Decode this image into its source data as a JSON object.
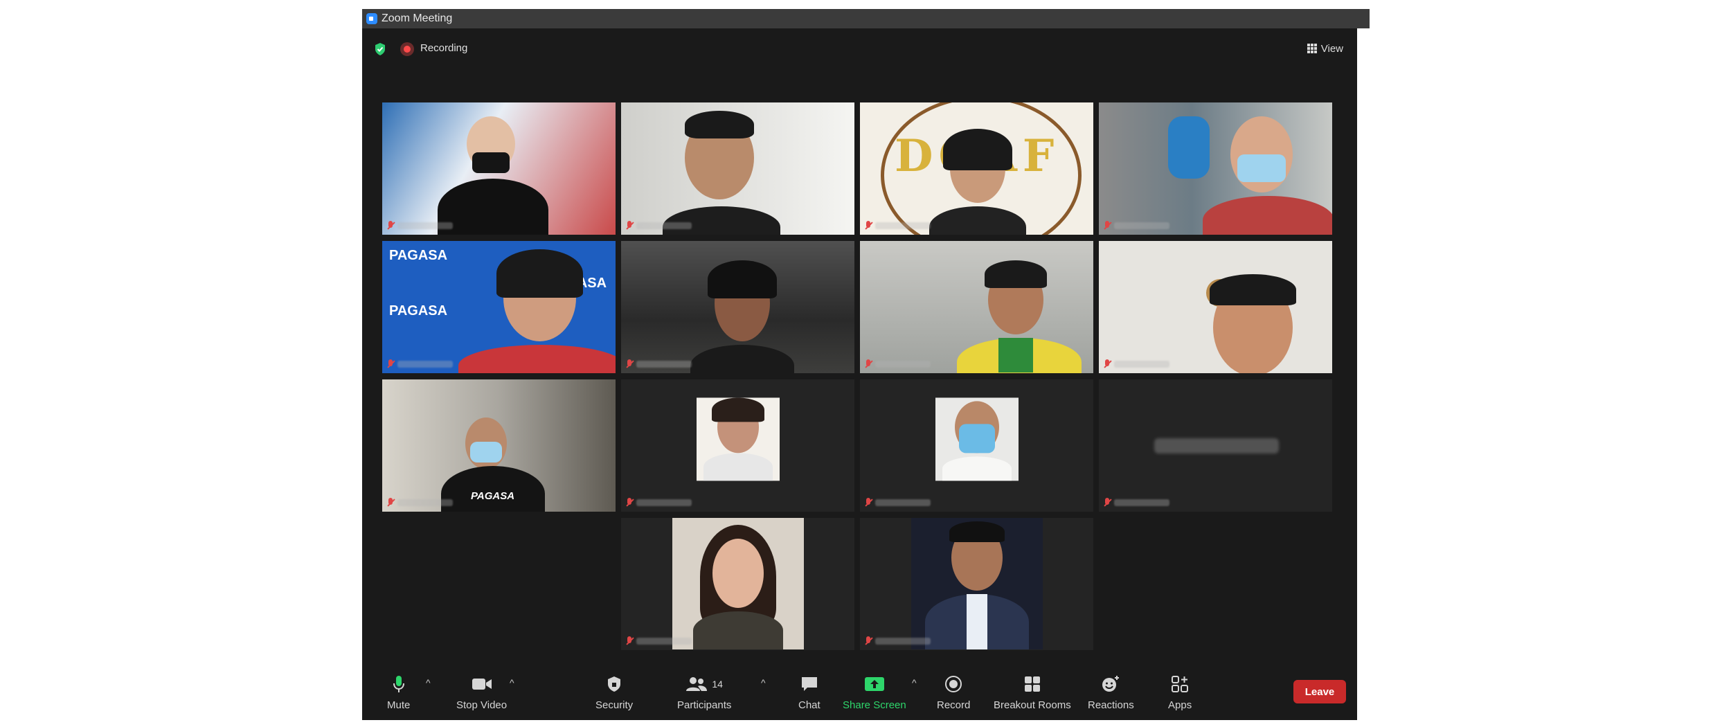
{
  "window": {
    "title": "Zoom Meeting"
  },
  "topbar": {
    "recording_label": "Recording",
    "view_label": "View"
  },
  "participants_count": "14",
  "tiles": [
    {
      "id": "t1",
      "bg": "#2f6fb5"
    },
    {
      "id": "t2",
      "bg": "#d8d8d6",
      "active": true
    },
    {
      "id": "t3",
      "bg": "#f3efe6",
      "sign": "DOAF"
    },
    {
      "id": "t4",
      "bg": "#7a8a90"
    },
    {
      "id": "t5",
      "bg": "#1e5ec0",
      "sign": "PAGASA"
    },
    {
      "id": "t6",
      "bg": "#3a3a38"
    },
    {
      "id": "t7",
      "bg": "#c9c9c5"
    },
    {
      "id": "t8",
      "bg": "#e6e4df"
    },
    {
      "id": "t9",
      "bg": "#c8c4bb",
      "shirt": "PAGASA"
    },
    {
      "id": "t10",
      "bg": "#242424",
      "avatar": true
    },
    {
      "id": "t11",
      "bg": "#242424",
      "avatar": true
    },
    {
      "id": "t12",
      "bg": "#242424"
    },
    {
      "id": "t13",
      "bg": "#242424",
      "avatar": true
    },
    {
      "id": "t14",
      "bg": "#242424",
      "avatar": true
    }
  ],
  "toolbar": {
    "mute": "Mute",
    "stop_video": "Stop Video",
    "security": "Security",
    "participants": "Participants",
    "chat": "Chat",
    "share_screen": "Share Screen",
    "record": "Record",
    "breakout_rooms": "Breakout Rooms",
    "reactions": "Reactions",
    "apps": "Apps",
    "leave": "Leave"
  },
  "colors": {
    "accent_green": "#2ed66b",
    "leave_red": "#c92a2a",
    "active_speaker": "#a8d64a"
  }
}
